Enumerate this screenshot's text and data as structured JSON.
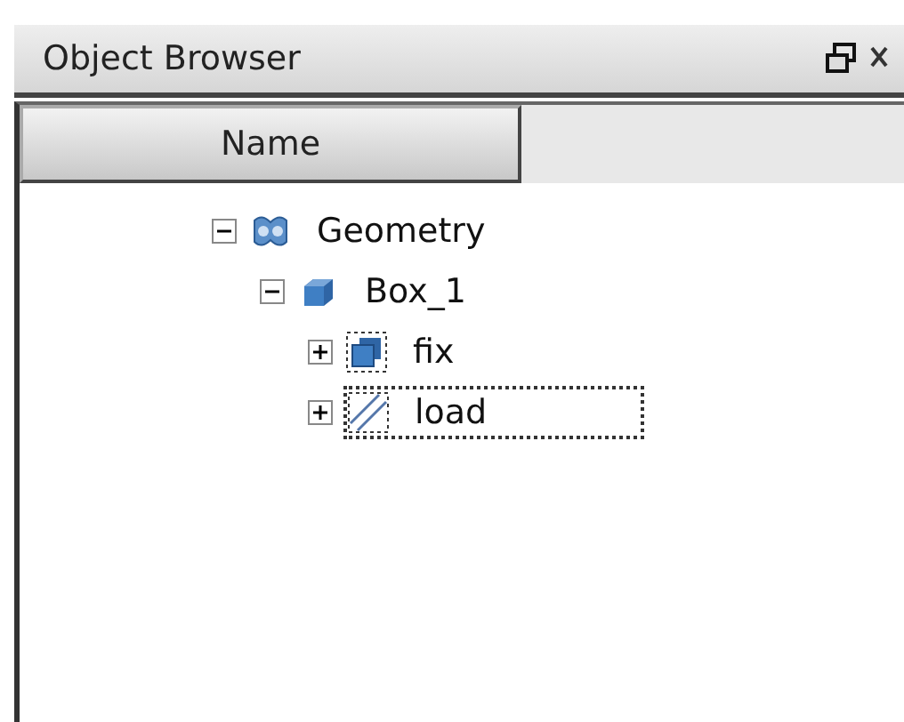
{
  "window": {
    "title": "Object Browser"
  },
  "table": {
    "columns": [
      "Name"
    ]
  },
  "tree": [
    {
      "label": "Geometry",
      "kind": "geometry",
      "expanded": true,
      "focused": false,
      "children": [
        {
          "label": "Box_1",
          "kind": "solid",
          "expanded": true,
          "focused": false,
          "children": [
            {
              "label": "fix",
              "kind": "group",
              "expanded": false,
              "focused": false
            },
            {
              "label": "load",
              "kind": "face",
              "expanded": false,
              "focused": true
            }
          ]
        }
      ]
    }
  ]
}
